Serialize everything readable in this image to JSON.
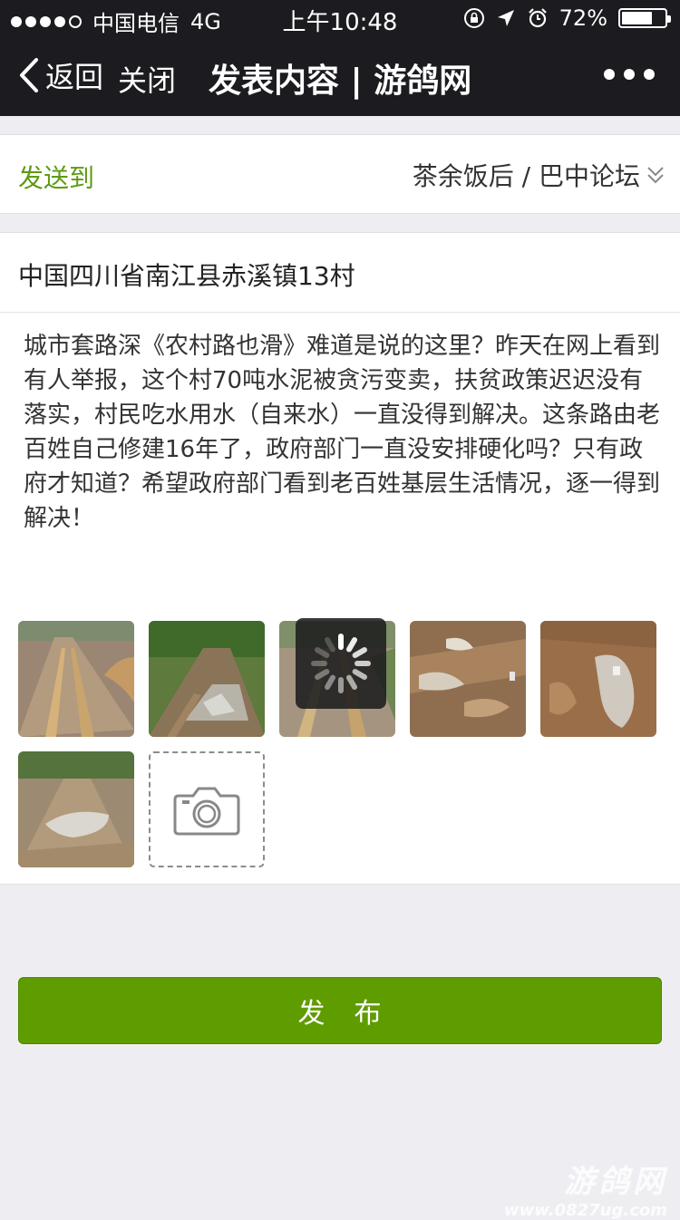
{
  "status_bar": {
    "carrier": "中国电信",
    "network": "4G",
    "time": "上午10:48",
    "battery": "72%",
    "battery_level": 0.72,
    "icons": [
      "lock-rotation-icon",
      "location-arrow-icon",
      "alarm-icon"
    ]
  },
  "nav": {
    "back_label": "返回",
    "close_label": "关闭",
    "title": "发表内容 | 游鸽网"
  },
  "send_to": {
    "label": "发送到",
    "target": "茶余饭后 / 巴中论坛"
  },
  "post": {
    "location": "中国四川省南江县赤溪镇13村",
    "body": "城市套路深《农村路也滑》难道是说的这里？昨天在网上看到有人举报，这个村70吨水泥被贪污变卖，扶贫政策迟迟没有落实，村民吃水用水（自来水）一直没得到解决。这条路由老百姓自己修建16年了，政府部门一直没安排硬化吗？只有政府才知道？希望政府部门看到老百姓基层生活情况，逐一得到解决！"
  },
  "photos_count": 6,
  "publish_label": "发　布",
  "watermark": {
    "logo": "游鸽网",
    "url": "www.0827ug.com"
  },
  "colors": {
    "accent": "#5f9c00",
    "label_green": "#5d9a12",
    "topbar": "#1c1c20"
  }
}
